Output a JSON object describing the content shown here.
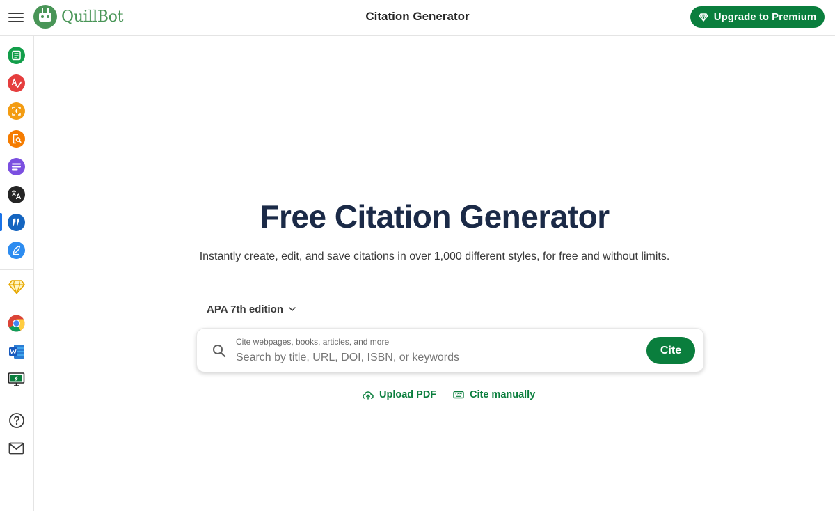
{
  "header": {
    "logo_text": "QuillBot",
    "title": "Citation Generator",
    "premium_label": "Upgrade to Premium"
  },
  "sidebar": {
    "items": [
      {
        "name": "paraphraser-icon",
        "color": "#129e4a"
      },
      {
        "name": "grammar-checker-icon",
        "color": "#e53e3e"
      },
      {
        "name": "ai-detector-icon",
        "color": "#f39c12"
      },
      {
        "name": "plagiarism-checker-icon",
        "color": "#f57c00"
      },
      {
        "name": "summarizer-icon",
        "color": "#7b4fe0"
      },
      {
        "name": "translator-icon",
        "color": "#252525"
      },
      {
        "name": "citation-generator-icon",
        "color": "#1565c0",
        "active": true
      },
      {
        "name": "quillbot-flow-icon",
        "color": "#2d8cf0"
      },
      {
        "name": "premium-diamond-icon",
        "color": "#e6a700"
      },
      {
        "name": "chrome-extension-icon",
        "color": "#4285f4"
      },
      {
        "name": "word-addin-icon",
        "color": "#185abd"
      },
      {
        "name": "desktop-app-icon",
        "color": "#0a7e3d"
      },
      {
        "name": "help-icon",
        "color": "#3b3b3b"
      },
      {
        "name": "mail-icon",
        "color": "#3b3b3b"
      }
    ]
  },
  "main": {
    "hero_title": "Free Citation Generator",
    "hero_subtitle": "Instantly create, edit, and save citations in over 1,000 different styles, for free and without limits.",
    "style_selected": "APA 7th edition",
    "search": {
      "hint": "Cite webpages, books, articles, and more",
      "placeholder": "Search by title, URL, DOI, ISBN, or keywords",
      "value": ""
    },
    "cite_label": "Cite",
    "upload_label": "Upload PDF",
    "manual_label": "Cite manually"
  },
  "colors": {
    "brand_green": "#0a7e3d",
    "logo_green": "#499557",
    "title_navy": "#1b2a47"
  }
}
